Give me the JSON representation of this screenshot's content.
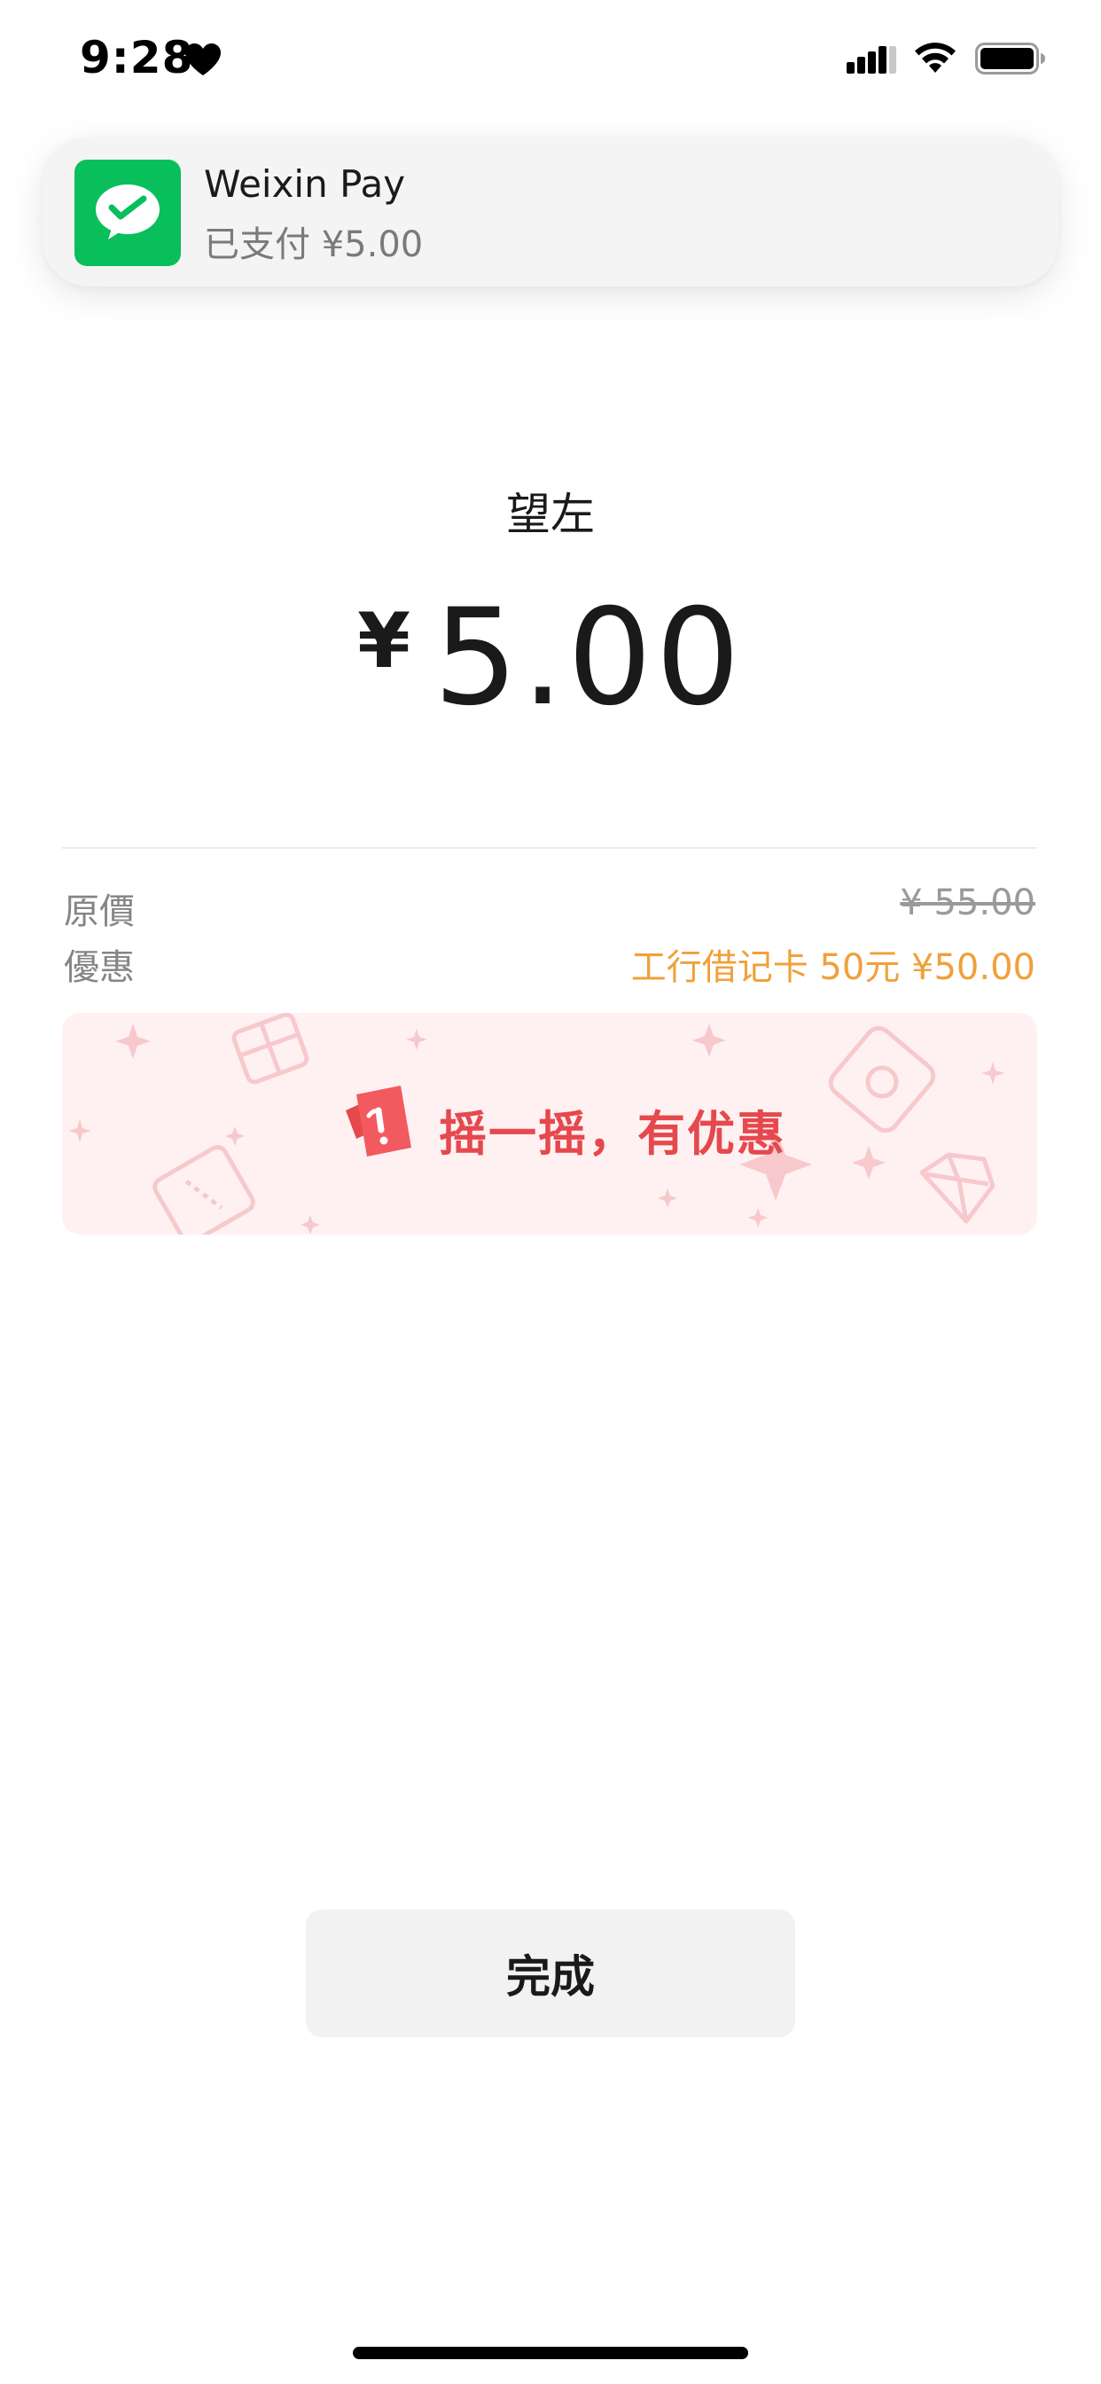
{
  "status_bar": {
    "time": "9:28",
    "icons": [
      "heart-icon",
      "cellular-signal-icon",
      "wifi-icon",
      "battery-icon"
    ]
  },
  "notification": {
    "app_name": "Weixin Pay",
    "message": "已支付 ¥5.00",
    "icon": "wechat-icon",
    "icon_color": "#09bf5c"
  },
  "payment": {
    "merchant": "望左",
    "currency_symbol": "¥",
    "amount": "5.00"
  },
  "details": [
    {
      "label": "原價",
      "value": "¥ 55.00"
    },
    {
      "label": "優惠",
      "value": "工行借记卡 50元 ¥50.00"
    }
  ],
  "promo": {
    "text": "摇一摇，有优惠",
    "icon": "shake-coupon-icon",
    "color": "#e5484d"
  },
  "actions": {
    "done_label": "完成"
  },
  "colors": {
    "accent_green": "#09bf5c",
    "discount_orange": "#f0a03a",
    "promo_red": "#e5484d"
  }
}
